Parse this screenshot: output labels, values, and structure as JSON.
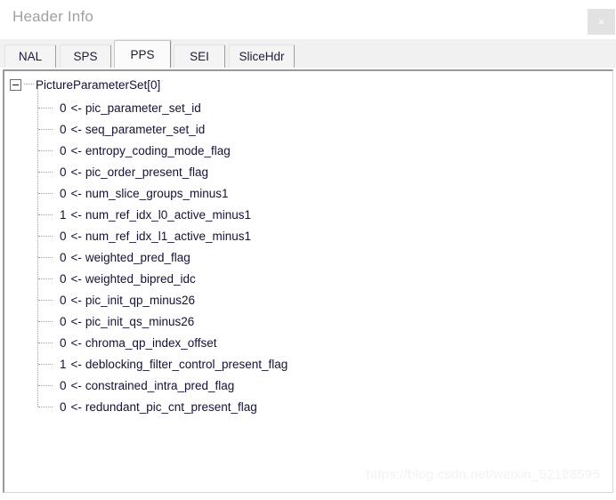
{
  "window": {
    "title": "Header Info",
    "close_label": "×",
    "close_icon": "close-icon"
  },
  "tabs": {
    "selected": "PPS",
    "items": [
      {
        "label": "NAL",
        "selected": false
      },
      {
        "label": "SPS",
        "selected": false
      },
      {
        "label": "PPS",
        "selected": true
      },
      {
        "label": "SEI",
        "selected": false
      },
      {
        "label": "SliceHdr",
        "selected": false
      }
    ]
  },
  "tree": {
    "root": {
      "label": "PictureParameterSet[0]",
      "expanded": true,
      "expander_glyph": "−"
    },
    "arrow": "<-",
    "children": [
      {
        "value": "0",
        "field": "pic_parameter_set_id"
      },
      {
        "value": "0",
        "field": "seq_parameter_set_id"
      },
      {
        "value": "0",
        "field": "entropy_coding_mode_flag"
      },
      {
        "value": "0",
        "field": "pic_order_present_flag"
      },
      {
        "value": "0",
        "field": "num_slice_groups_minus1"
      },
      {
        "value": "1",
        "field": "num_ref_idx_l0_active_minus1"
      },
      {
        "value": "0",
        "field": "num_ref_idx_l1_active_minus1"
      },
      {
        "value": "0",
        "field": "weighted_pred_flag"
      },
      {
        "value": "0",
        "field": "weighted_bipred_idc"
      },
      {
        "value": "0",
        "field": "pic_init_qp_minus26"
      },
      {
        "value": "0",
        "field": "pic_init_qs_minus26"
      },
      {
        "value": "0",
        "field": "chroma_qp_index_offset"
      },
      {
        "value": "1",
        "field": "deblocking_filter_control_present_flag"
      },
      {
        "value": "0",
        "field": "constrained_intra_pred_flag"
      },
      {
        "value": "0",
        "field": "redundant_pic_cnt_present_flag"
      }
    ]
  },
  "watermark": {
    "text": "https://blog.csdn.net/weixin_52188595"
  },
  "colors": {
    "text": "#121236",
    "title": "#a0a0a0",
    "tabstrip_bg": "#f1f1f1",
    "panel_bg": "#ffffff",
    "watermark": "#f2f2f2"
  }
}
